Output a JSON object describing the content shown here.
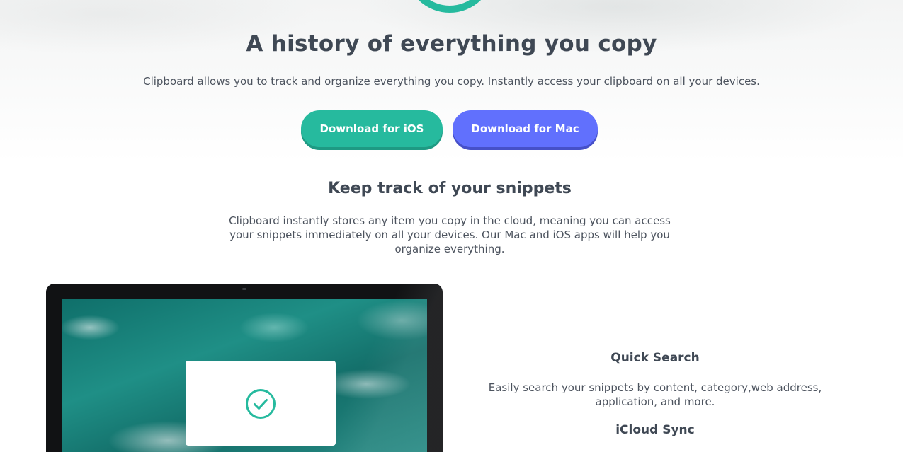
{
  "hero": {
    "title": "A history of everything you copy",
    "subtitle": "Clipboard allows you to track and organize everything you copy. Instantly access your clipboard on all your devices."
  },
  "buttons": {
    "ios_label": "Download for iOS",
    "mac_label": "Download for Mac"
  },
  "snippets": {
    "title": "Keep track of your snippets",
    "text": "Clipboard instantly stores any item you copy in the cloud, meaning you can access your snippets immediately on all your devices. Our Mac and iOS apps will help you organize everything."
  },
  "features": [
    {
      "title": "Quick Search",
      "text": "Easily search your snippets by content, category,web address, application, and more."
    },
    {
      "title": "iCloud Sync",
      "text": ""
    }
  ],
  "colors": {
    "accent_teal": "#26ba9e",
    "accent_blue": "#6170fd",
    "heading": "#3f4854",
    "body_text": "#4c535e"
  },
  "icons": {
    "hero_logo": "clipboard-logo-icon",
    "screen_check": "check-circle-icon"
  }
}
